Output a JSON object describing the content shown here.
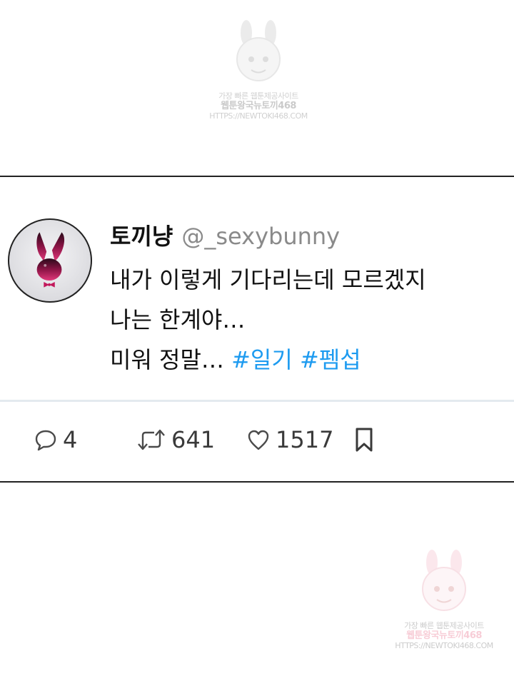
{
  "watermark": {
    "line1": "가장 빠른 웹툰제공사이트",
    "line2": "웹툰왕국뉴토끼468",
    "line3": "HTTPS://NEWTOKI468.COM"
  },
  "tweet": {
    "display_name": "토끼냥",
    "handle": "@_sexybunny",
    "lines": [
      "내가 이렇게 기다리는데 모르겠지",
      "나는 한계야…"
    ],
    "line3_text": "미워 정말…",
    "hashtags": [
      "#일기",
      "#펨섭"
    ],
    "reply_count": "4",
    "retweet_count": "641",
    "like_count": "1517"
  },
  "colors": {
    "hashtag": "#1d9bf0",
    "avatar_accent": "#c2185b",
    "divider": "#e4eaef"
  },
  "icons": {
    "reply": "speech-bubble-icon",
    "retweet": "retweet-arrows-icon",
    "like": "heart-icon",
    "bookmark": "bookmark-icon"
  }
}
